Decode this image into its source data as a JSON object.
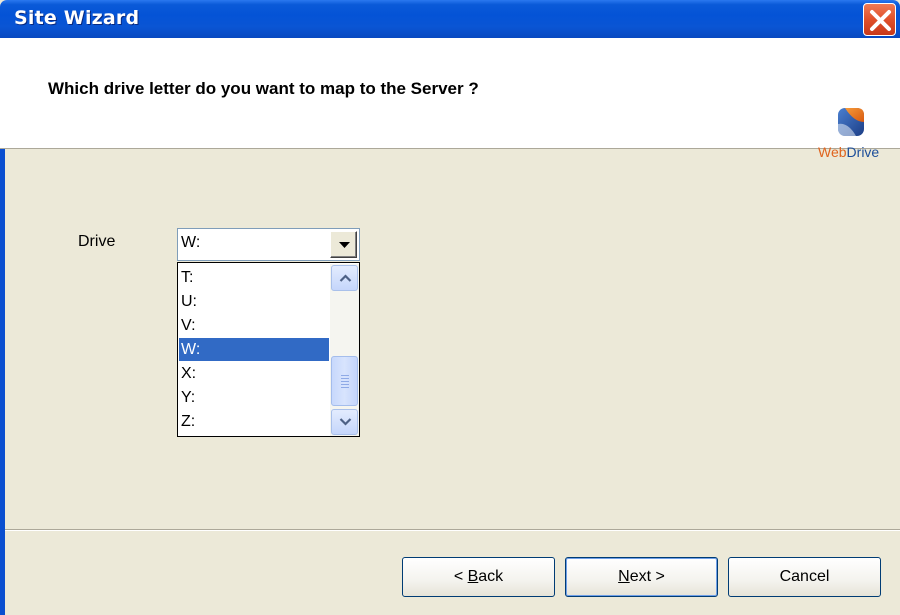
{
  "window": {
    "title": "Site Wizard"
  },
  "header": {
    "question": "Which drive letter do you want to map to the Server ?",
    "logo_web": "Web",
    "logo_drive": "Drive"
  },
  "form": {
    "drive_label": "Drive",
    "selected_value": "W:",
    "options": [
      "T:",
      "U:",
      "V:",
      "W:",
      "X:",
      "Y:",
      "Z:"
    ],
    "selected_index": 3
  },
  "buttons": {
    "back": {
      "prefix": "< ",
      "accel": "B",
      "rest": "ack"
    },
    "next": {
      "accel": "N",
      "rest": "ext >"
    },
    "cancel": "Cancel"
  },
  "icons": {
    "close": "close-icon",
    "combo_arrow": "chevron-down-icon",
    "scroll_up": "chevron-up-icon",
    "scroll_down": "chevron-down-icon",
    "logo": "webdrive-logo-icon"
  },
  "colors": {
    "titlebar": "#0453d6",
    "selection": "#316ac5",
    "dialog_bg": "#ece9d8",
    "close": "#e0502a"
  }
}
